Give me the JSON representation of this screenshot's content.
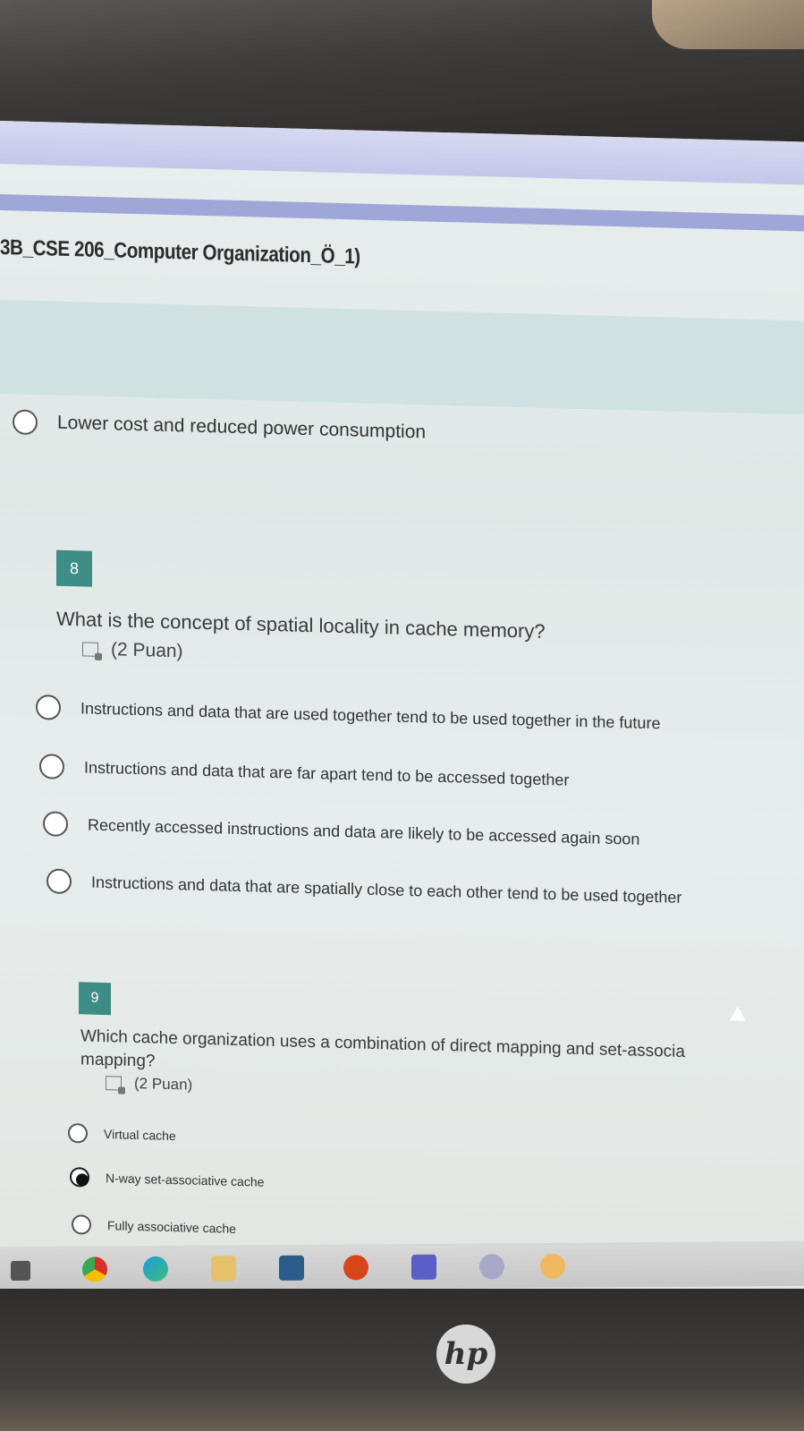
{
  "course": {
    "title": "3B_CSE 206_Computer Organization_Ö_1)"
  },
  "prev_question": {
    "option": "Lower cost and reduced power consumption"
  },
  "questions": [
    {
      "number": "8",
      "text": "What is the concept of spatial locality in cache memory?",
      "points": "(2 Puan)",
      "options": [
        "Instructions and data that are used together tend to be used together in the future",
        "Instructions and data that are far apart tend to be accessed together",
        "Recently accessed instructions and data are likely to be accessed again soon",
        "Instructions and data that are spatially close to each other tend to be used together"
      ]
    },
    {
      "number": "9",
      "text": "Which cache organization uses a combination of direct mapping and set-associa",
      "text2": "mapping?",
      "points": "(2 Puan)",
      "options": [
        "Virtual cache",
        "N-way set-associative cache",
        "Fully associative cache"
      ],
      "selected_index": 1
    }
  ],
  "device": {
    "brand": "hp"
  }
}
